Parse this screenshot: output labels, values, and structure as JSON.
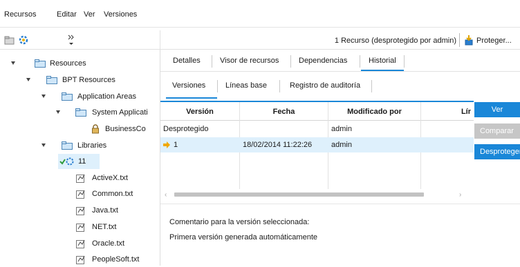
{
  "menu": [
    "Recursos",
    "Editar",
    "Ver",
    "Versiones"
  ],
  "toolbar": {
    "status": "1 Recurso (desprotegido por admin)",
    "proteger_label": "Proteger..."
  },
  "tree": [
    {
      "label": "Resources",
      "icon": "folder-icon"
    },
    {
      "label": "BPT Resources",
      "icon": "folder-icon"
    },
    {
      "label": "Application Areas",
      "icon": "folder-icon"
    },
    {
      "label": "System Applicati",
      "icon": "folder-icon"
    },
    {
      "label": "BusinessCo",
      "icon": "lock-icon"
    },
    {
      "label": "Libraries",
      "icon": "folder-icon"
    },
    {
      "label": "11",
      "icon": "library-checkedout-icon"
    },
    {
      "label": "ActiveX.txt",
      "icon": "file-icon"
    },
    {
      "label": "Common.txt",
      "icon": "file-icon"
    },
    {
      "label": "Java.txt",
      "icon": "file-icon"
    },
    {
      "label": "NET.txt",
      "icon": "file-icon"
    },
    {
      "label": "Oracle.txt",
      "icon": "file-icon"
    },
    {
      "label": "PeopleSoft.txt",
      "icon": "file-icon"
    }
  ],
  "tabs": [
    "Detalles",
    "Visor de recursos",
    "Dependencias",
    "Historial"
  ],
  "active_tab": "Historial",
  "subtabs": [
    "Versiones",
    "Líneas base",
    "Registro de auditoría"
  ],
  "active_subtab": "Versiones",
  "grid": {
    "columns": [
      "Versión",
      "Fecha",
      "Modificado por",
      "Lír"
    ],
    "rows": [
      [
        "Desprotegido",
        "",
        "admin",
        ""
      ],
      [
        "1",
        "18/02/2014 11:22:26",
        "admin",
        ""
      ]
    ],
    "selected_row": 1
  },
  "side_buttons": [
    "Ver",
    "Comparar",
    "Desproteger"
  ],
  "comment": {
    "label": "Comentario para la versión seleccionada:",
    "text": "Primera versión generada automáticamente"
  },
  "colors": {
    "accent": "#1a87d8",
    "selected_row": "#def0fc",
    "button_disabled": "#c6c6c6"
  }
}
